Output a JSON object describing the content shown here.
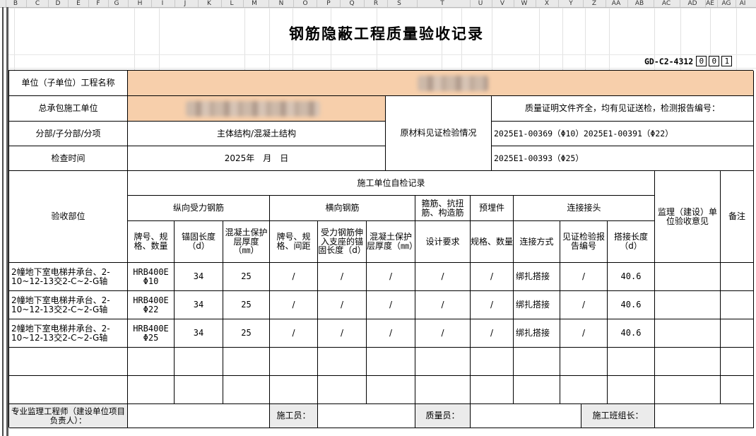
{
  "columns": [
    "B",
    "C",
    "D",
    "E",
    "F",
    "G",
    "H",
    "I",
    "J",
    "K",
    "L",
    "M",
    "N",
    "O",
    "P",
    "Q",
    "R",
    "S",
    "T",
    "U",
    "V",
    "W",
    "X",
    "Y",
    "Z",
    "AA",
    "AB",
    "AC",
    "AD",
    "AE",
    "AG",
    "AI"
  ],
  "title": "钢筋隐蔽工程质量验收记录",
  "doc_code": "GD-C2-4312",
  "doc_code_digits": [
    "0",
    "0",
    "1"
  ],
  "info": {
    "project_label": "单位（子单位）工程名称",
    "contractor_label": "总承包施工单位",
    "division_label": "分部/子分部/分项",
    "division_value": "主体结构/混凝土结构",
    "check_time_label": "检查时间",
    "check_time_value": "2025年　月　日",
    "material_label": "原材料见证检验情况",
    "material_line1": "质量证明文件齐全，均有见证送检，检测报告编号：",
    "material_line2": "2025E1-00369（Φ10）2025E1-00391（Φ22）",
    "material_line3": "2025E1-00393（Φ25）"
  },
  "headers": {
    "part": "验收部位",
    "self_check": "施工单位自检记录",
    "longitudinal": "纵向受力钢筋",
    "transverse": "横向钢筋",
    "stirrup": "箍筋、抗扭筋、构造筋",
    "embedded": "预埋件",
    "joint": "连接接头",
    "supervisor_opinion": "监理（建设）单位验收意见",
    "remark": "备注",
    "long_grade": "牌号、规格、数量",
    "long_anchor": "锚固长度（d）",
    "long_cover": "混凝土保护层厚度（㎜）",
    "trans_grade": "牌号、规格、间距",
    "trans_anchor": "受力钢筋伸入支座的锚固长度（d）",
    "trans_cover": "混凝土保护层厚度（㎜）",
    "stirrup_req": "设计要求",
    "embedded_spec": "规格、数量",
    "joint_method": "连接方式",
    "joint_report": "见证检验报告编号",
    "joint_length": "搭接长度（d）"
  },
  "rows": [
    {
      "part": "2幢地下室电梯井承台、2-10~12-13交2-C~2-G轴",
      "grade": "HRB400E Φ10",
      "anchor": "34",
      "cover": "25",
      "t_grade": "/",
      "t_anchor": "/",
      "t_cover": "/",
      "stirrup": "/",
      "embedded": "/",
      "method": "绑扎搭接",
      "report": "/",
      "length": "40.6"
    },
    {
      "part": "2幢地下室电梯井承台、2-10~12-13交2-C~2-G轴",
      "grade": "HRB400E Φ22",
      "anchor": "34",
      "cover": "25",
      "t_grade": "/",
      "t_anchor": "/",
      "t_cover": "/",
      "stirrup": "/",
      "embedded": "/",
      "method": "绑扎搭接",
      "report": "/",
      "length": "40.6"
    },
    {
      "part": "2幢地下室电梯井承台、2-10~12-13交2-C~2-G轴",
      "grade": "HRB400E Φ25",
      "anchor": "34",
      "cover": "25",
      "t_grade": "/",
      "t_anchor": "/",
      "t_cover": "/",
      "stirrup": "/",
      "embedded": "/",
      "method": "绑扎搭接",
      "report": "/",
      "length": "40.6"
    }
  ],
  "footer": {
    "engineer": "专业监理工程师（建设单位项目负责人）：",
    "worker": "施工员：",
    "quality": "质量员：",
    "leader": "施工班组长："
  }
}
